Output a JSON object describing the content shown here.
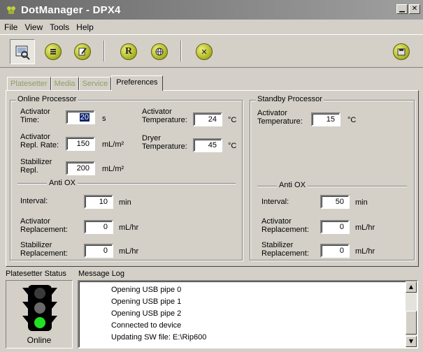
{
  "window": {
    "title": "DotManager - DPX4",
    "minimize_glyph": "▁",
    "close_glyph": "✕"
  },
  "menu": [
    {
      "label": "File"
    },
    {
      "label": "View"
    },
    {
      "label": "Tools"
    },
    {
      "label": "Help"
    }
  ],
  "toolbar": {
    "buttons": [
      "preview-icon",
      "list-icon",
      "edit-icon",
      "r-icon",
      "globe-icon",
      "cancel-icon",
      "save-icon"
    ],
    "r_glyph": "R",
    "cancel_glyph": "✕"
  },
  "tabs": [
    {
      "label": "Platesetter"
    },
    {
      "label": "Media"
    },
    {
      "label": "Service"
    },
    {
      "label": "Preferences"
    }
  ],
  "online": {
    "title": "Online Processor",
    "activator_time_label_1": "Activator",
    "activator_time_label_2": "Time:",
    "activator_time": "20",
    "activator_time_unit": "s",
    "activator_temp_label_1": "Activator",
    "activator_temp_label_2": "Temperature:",
    "activator_temp": "24",
    "temp_unit": "°C",
    "repl_rate_label_1": "Activator",
    "repl_rate_label_2": "Repl. Rate:",
    "repl_rate": "150",
    "area_unit": "mL/m²",
    "dryer_temp_label_1": "Dryer",
    "dryer_temp_label_2": "Temperature:",
    "dryer_temp": "45",
    "stab_repl_label_1": "Stabilizer",
    "stab_repl_label_2": "Repl.",
    "stab_repl": "200",
    "anti_ox_title": "Anti OX",
    "interval_label": "Interval:",
    "interval": "10",
    "interval_unit": "min",
    "act_replacement_label_1": "Activator",
    "act_replacement_label_2": "Replacement:",
    "act_replacement": "0",
    "flow_unit": "mL/hr",
    "stab_replacement_label_1": "Stabilizer",
    "stab_replacement_label_2": "Replacement:",
    "stab_replacement": "0"
  },
  "standby": {
    "title": "Standby Processor",
    "activator_temp_label_1": "Activator",
    "activator_temp_label_2": "Temperature:",
    "activator_temp": "15",
    "temp_unit": "°C",
    "anti_ox_title": "Anti OX",
    "interval_label": "Interval:",
    "interval": "50",
    "interval_unit": "min",
    "act_replacement_label_1": "Activator",
    "act_replacement_label_2": "Replacement:",
    "act_replacement": "0",
    "flow_unit": "mL/hr",
    "stab_replacement_label_1": "Stabilizer",
    "stab_replacement_label_2": "Replacement:",
    "stab_replacement": "0"
  },
  "status": {
    "label": "Platesetter Status",
    "state": "Online",
    "light_colors": {
      "red": "#3a3a3a",
      "yellow": "#6a6a6a",
      "green": "#22e022"
    }
  },
  "log": {
    "label": "Message Log",
    "lines": [
      "Opening USB pipe 0",
      "Opening USB pipe 1",
      "Opening USB pipe 2",
      "Connected to device",
      "Updating SW file: E:\\Rip600"
    ],
    "scroll_up_glyph": "▲",
    "scroll_down_glyph": "▼"
  }
}
